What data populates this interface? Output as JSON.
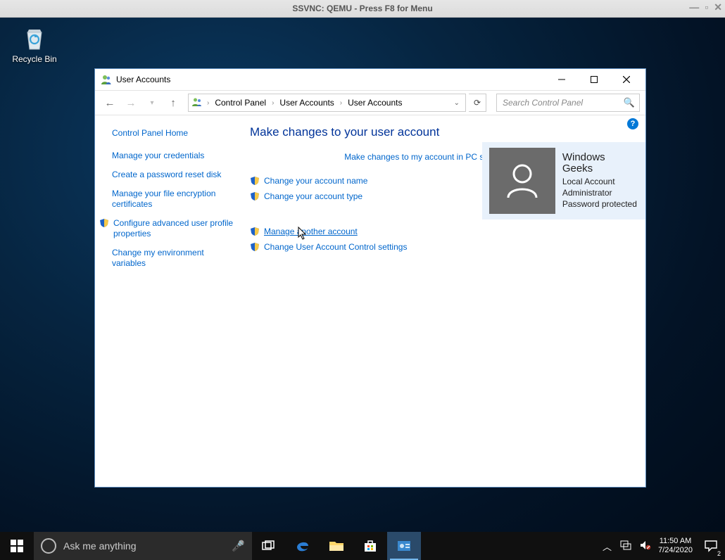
{
  "hostTitle": "SSVNC: QEMU - Press F8 for Menu",
  "recycleBin": "Recycle Bin",
  "cpTitle": "User Accounts",
  "breadcrumbs": [
    "Control Panel",
    "User Accounts",
    "User Accounts"
  ],
  "searchPlaceholder": "Search Control Panel",
  "leftPane": {
    "home": "Control Panel Home",
    "items": [
      {
        "label": "Manage your credentials",
        "shield": false
      },
      {
        "label": "Create a password reset disk",
        "shield": false
      },
      {
        "label": "Manage your file encryption certificates",
        "shield": false
      },
      {
        "label": "Configure advanced user profile properties",
        "shield": true
      },
      {
        "label": "Change my environment variables",
        "shield": false
      }
    ]
  },
  "main": {
    "heading": "Make changes to your user account",
    "pcSettings": "Make changes to my account in PC settings",
    "links1": [
      "Change your account name",
      "Change your account type"
    ],
    "links2": [
      "Manage another account",
      "Change User Account Control settings"
    ]
  },
  "user": {
    "name": "Windows Geeks",
    "lines": [
      "Local Account",
      "Administrator",
      "Password protected"
    ]
  },
  "taskbar": {
    "search": "Ask me anything",
    "time": "11:50 AM",
    "date": "7/24/2020",
    "notif": "2"
  }
}
